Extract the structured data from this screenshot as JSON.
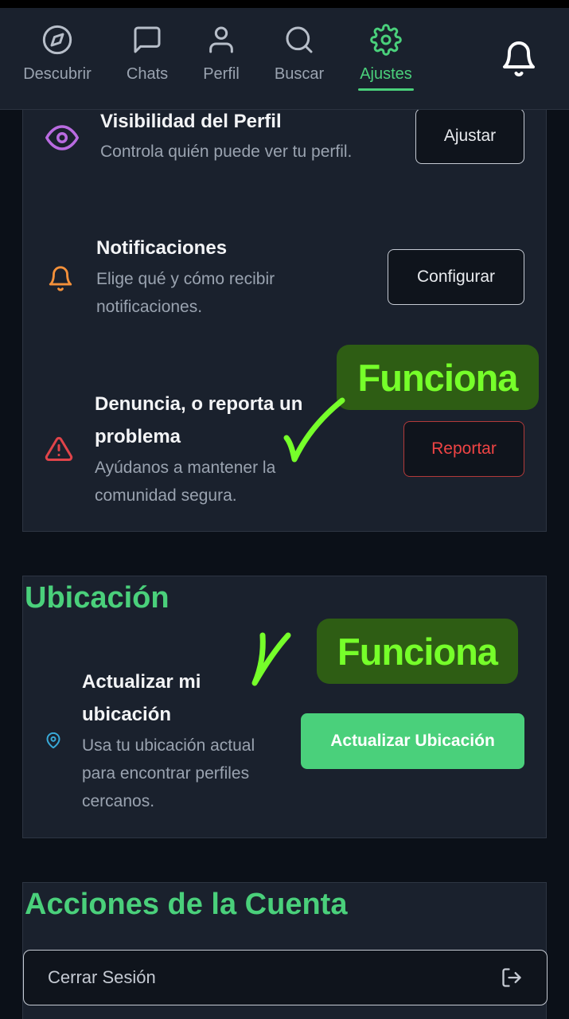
{
  "nav": {
    "items": [
      {
        "label": "Descubrir",
        "icon": "compass-icon"
      },
      {
        "label": "Chats",
        "icon": "chat-icon"
      },
      {
        "label": "Perfil",
        "icon": "user-icon"
      },
      {
        "label": "Buscar",
        "icon": "search-icon"
      },
      {
        "label": "Ajustes",
        "icon": "gear-icon"
      }
    ],
    "active": "Ajustes",
    "bell_icon": "bell-icon"
  },
  "privacy": {
    "visibility": {
      "title": "Visibilidad del Perfil",
      "desc": "Controla quién puede ver tu perfil.",
      "button": "Ajustar",
      "icon": "eye-icon"
    },
    "notifications": {
      "title": "Notificaciones",
      "desc_line1": "Elige qué y cómo recibir",
      "desc_line2": "notificaciones.",
      "button": "Configurar",
      "icon": "bell-icon"
    },
    "report": {
      "title_line1": "Denuncia, o reporta un",
      "title_line2": "problema",
      "desc_line1": "Ayúdanos a mantener la",
      "desc_line2": "comunidad segura.",
      "button": "Reportar",
      "icon": "warning-icon"
    }
  },
  "location": {
    "section_title": "Ubicación",
    "title_line1": "Actualizar mi",
    "title_line2": "ubicación",
    "desc_line1": "Usa tu ubicación actual",
    "desc_line2": "para encontrar perfiles",
    "desc_line3": "cercanos.",
    "button": "Actualizar Ubicación",
    "icon": "map-pin-icon"
  },
  "account": {
    "section_title": "Acciones de la Cuenta",
    "logout_label": "Cerrar Sesión",
    "logout_icon": "logout-icon"
  },
  "annotations": {
    "note1": "Funciona",
    "note2": "Funciona"
  },
  "colors": {
    "accent": "#4ad07b",
    "danger": "#ef4444",
    "background": "#0b1018",
    "card": "#1a212d",
    "note_bg": "#2e5d14",
    "note_text": "#76ff2a"
  }
}
